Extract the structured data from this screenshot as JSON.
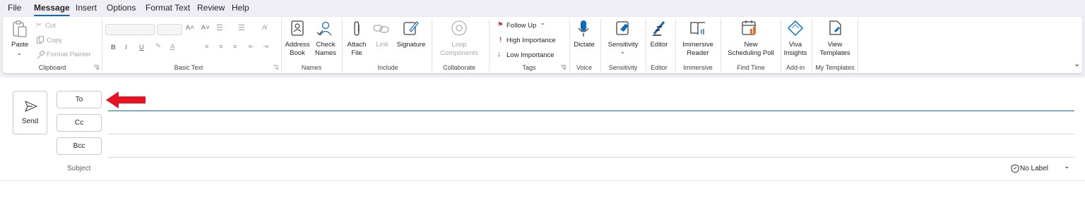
{
  "menu": {
    "tabs": [
      {
        "label": "File"
      },
      {
        "label": "Message",
        "active": true
      },
      {
        "label": "Insert"
      },
      {
        "label": "Options"
      },
      {
        "label": "Format Text"
      },
      {
        "label": "Review"
      },
      {
        "label": "Help"
      }
    ]
  },
  "ribbon": {
    "clipboard": {
      "paste": "Paste",
      "cut": "Cut",
      "copy": "Copy",
      "format_painter": "Format Painter",
      "group": "Clipboard"
    },
    "basic_text": {
      "group": "Basic Text"
    },
    "names": {
      "address_book_1": "Address",
      "address_book_2": "Book",
      "check_names_1": "Check",
      "check_names_2": "Names",
      "group": "Names"
    },
    "include": {
      "attach_1": "Attach",
      "attach_2": "File",
      "link": "Link",
      "signature": "Signature",
      "group": "Include"
    },
    "collaborate": {
      "loop_1": "Loop",
      "loop_2": "Components",
      "group": "Collaborate"
    },
    "tags": {
      "follow_up": "Follow Up",
      "high": "High Importance",
      "low": "Low Importance",
      "group": "Tags"
    },
    "voice": {
      "dictate": "Dictate",
      "group": "Voice"
    },
    "sensitivity": {
      "button": "Sensitivity",
      "group": "Sensitivity"
    },
    "editor": {
      "button": "Editor",
      "group": "Editor"
    },
    "immersive": {
      "reader_1": "Immersive",
      "reader_2": "Reader",
      "group": "Immersive"
    },
    "find_time": {
      "poll_1": "New",
      "poll_2": "Scheduling Poll",
      "group": "Find Time"
    },
    "addin": {
      "viva_1": "Viva",
      "viva_2": "Insights",
      "group": "Add-in"
    },
    "templates": {
      "view_1": "View",
      "view_2": "Templates",
      "group": "My Templates"
    }
  },
  "compose": {
    "send": "Send",
    "to": "To",
    "cc": "Cc",
    "bcc": "Bcc",
    "subject": "Subject",
    "sensitivity_label": "No Label"
  },
  "colors": {
    "accent": "#0f6cbd",
    "annotation_arrow": "#e81123",
    "follow_up_flag": "#d13438"
  }
}
